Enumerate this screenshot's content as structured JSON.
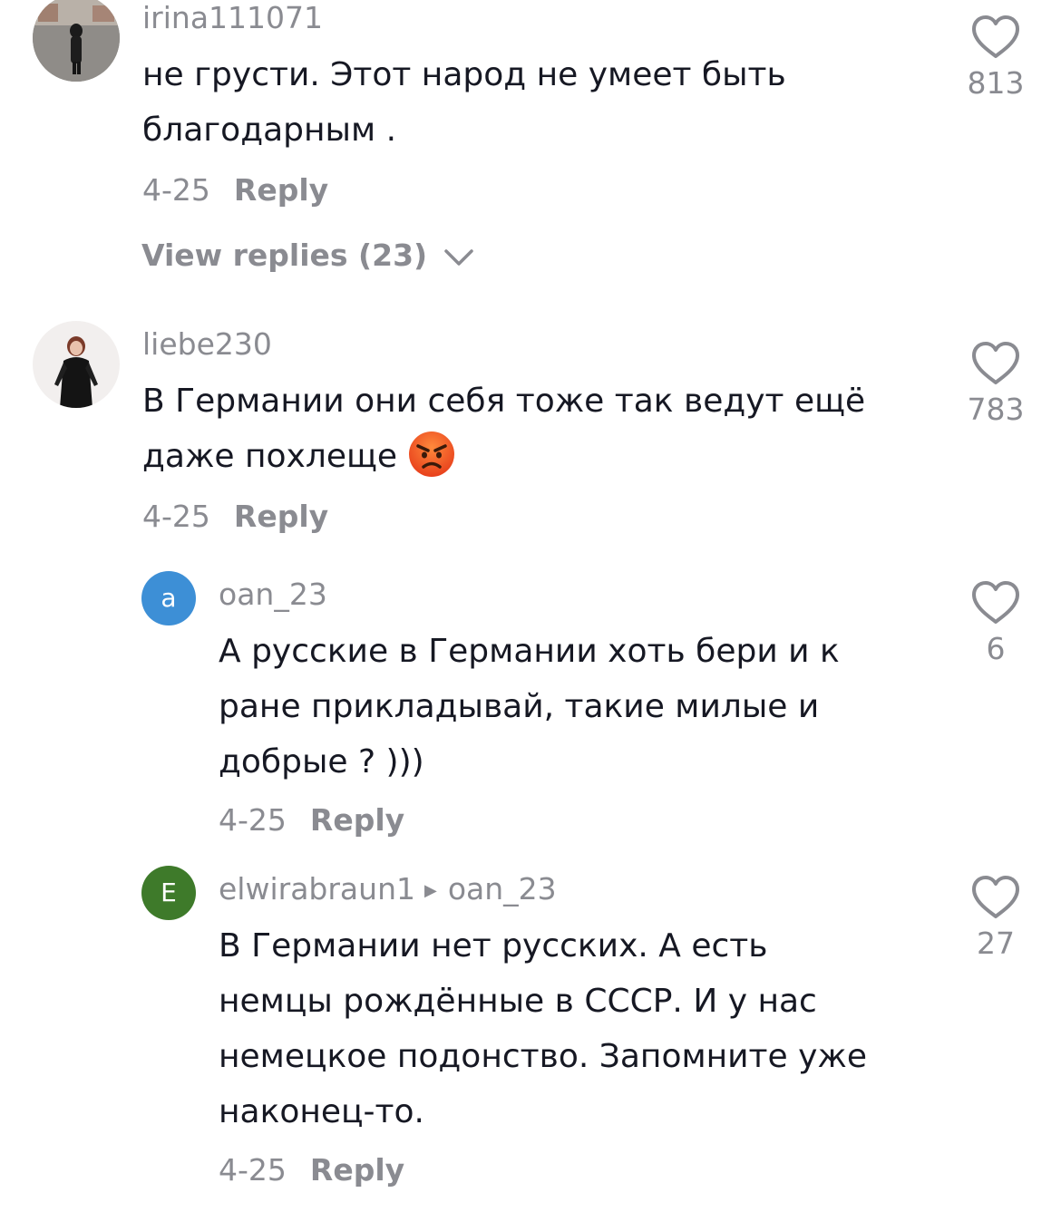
{
  "comments": [
    {
      "username": "irina111071",
      "lines": [
        "не грусти. Этот народ не умеет быть",
        "благодарным ."
      ],
      "date": "4-25",
      "reply_label": "Reply",
      "likes": "813",
      "view_replies": "View replies (23)"
    },
    {
      "username": "liebe230",
      "lines": [
        "В Германии они себя тоже так ведут ещё",
        "даже похлеще"
      ],
      "emoji": "angry-face",
      "date": "4-25",
      "reply_label": "Reply",
      "likes": "783"
    }
  ],
  "replies": [
    {
      "avatar_letter": "a",
      "avatar_color": "#3d8fd6",
      "username": "oan_23",
      "lines": [
        "А русские в Германии хоть бери и к",
        "ране прикладывай, такие милые и",
        "добрые ? )))"
      ],
      "date": "4-25",
      "reply_label": "Reply",
      "likes": "6"
    },
    {
      "avatar_letter": "E",
      "avatar_color": "#3e7a2a",
      "username": "elwirabraun1",
      "reply_to": "oan_23",
      "lines": [
        "В Германии нет русских. А есть",
        "немцы рождённые в СССР. И у нас",
        "немецкое подонство. Запомните уже",
        "наконец-то."
      ],
      "date": "4-25",
      "reply_label": "Reply",
      "likes": "27"
    }
  ],
  "colors": {
    "text": "#161823",
    "muted": "#8a8b91"
  }
}
